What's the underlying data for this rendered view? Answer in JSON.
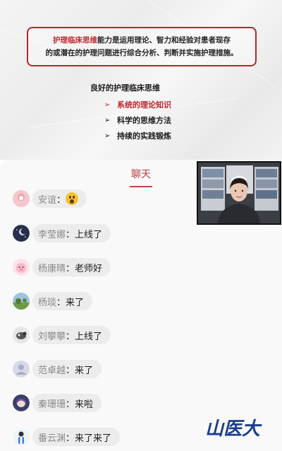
{
  "slide": {
    "definition": {
      "highlight": "护理临床思维",
      "line1_rest": "能力是运用理论、智力和经验对患者现存",
      "line2": "的或潜在的护理问题进行综合分析、判断并实施护理措施。"
    },
    "subtitle": "良好的护理临床思维",
    "list": [
      {
        "label": "系统的理论知识",
        "active": true
      },
      {
        "label": "科学的思维方法",
        "active": false
      },
      {
        "label": "持续的实践锻炼",
        "active": false
      }
    ],
    "accent_color": "#c0252c"
  },
  "chat": {
    "title": "聊天",
    "messages": [
      {
        "name": "安谊",
        "text": "",
        "emoji": "surprised-face-emoji",
        "avatar": "pink-round-avatar"
      },
      {
        "name": "李莹娜",
        "text": "上线了",
        "avatar": "dark-moon-avatar"
      },
      {
        "name": "杨康晴",
        "text": "老师好",
        "avatar": "pink-cartoon-avatar"
      },
      {
        "name": "杨琰",
        "text": "来了",
        "avatar": "landscape-avatar"
      },
      {
        "name": "刘攀攀",
        "text": "上线了",
        "avatar": "gray-bird-avatar"
      },
      {
        "name": "范卓越",
        "text": "来了",
        "avatar": "default-person-avatar"
      },
      {
        "name": "秦珊珊",
        "text": "来啦",
        "avatar": "anime-girl-avatar"
      },
      {
        "name": "番云渊",
        "text": "来了来了",
        "avatar": "doctor-avatar"
      }
    ],
    "separator": "："
  },
  "video": {
    "icon": "teacher-video-feed"
  },
  "logo": {
    "text": "山医大",
    "color": "#1a3e8c"
  }
}
